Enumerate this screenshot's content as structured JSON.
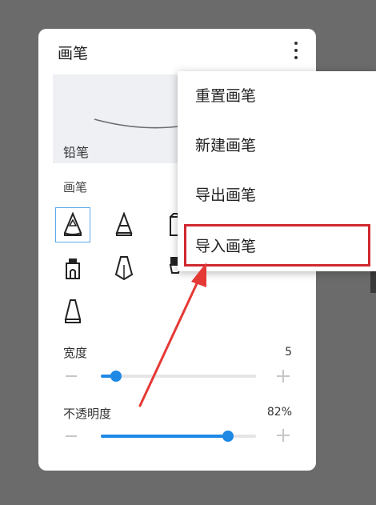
{
  "panel": {
    "title": "画笔"
  },
  "preview": {
    "brush_name": "铅笔"
  },
  "brushes": {
    "section_label": "画笔"
  },
  "width": {
    "label": "宽度",
    "value": "5",
    "fraction": 0.1
  },
  "opacity": {
    "label": "不透明度",
    "value": "82%",
    "fraction": 0.82
  },
  "menu": {
    "items": [
      {
        "label": "重置画笔"
      },
      {
        "label": "新建画笔"
      },
      {
        "label": "导出画笔"
      },
      {
        "label": "导入画笔"
      }
    ]
  },
  "colors": {
    "accent": "#1e88e5",
    "highlight": "#d0282f",
    "annotation_arrow": "#e53935"
  }
}
